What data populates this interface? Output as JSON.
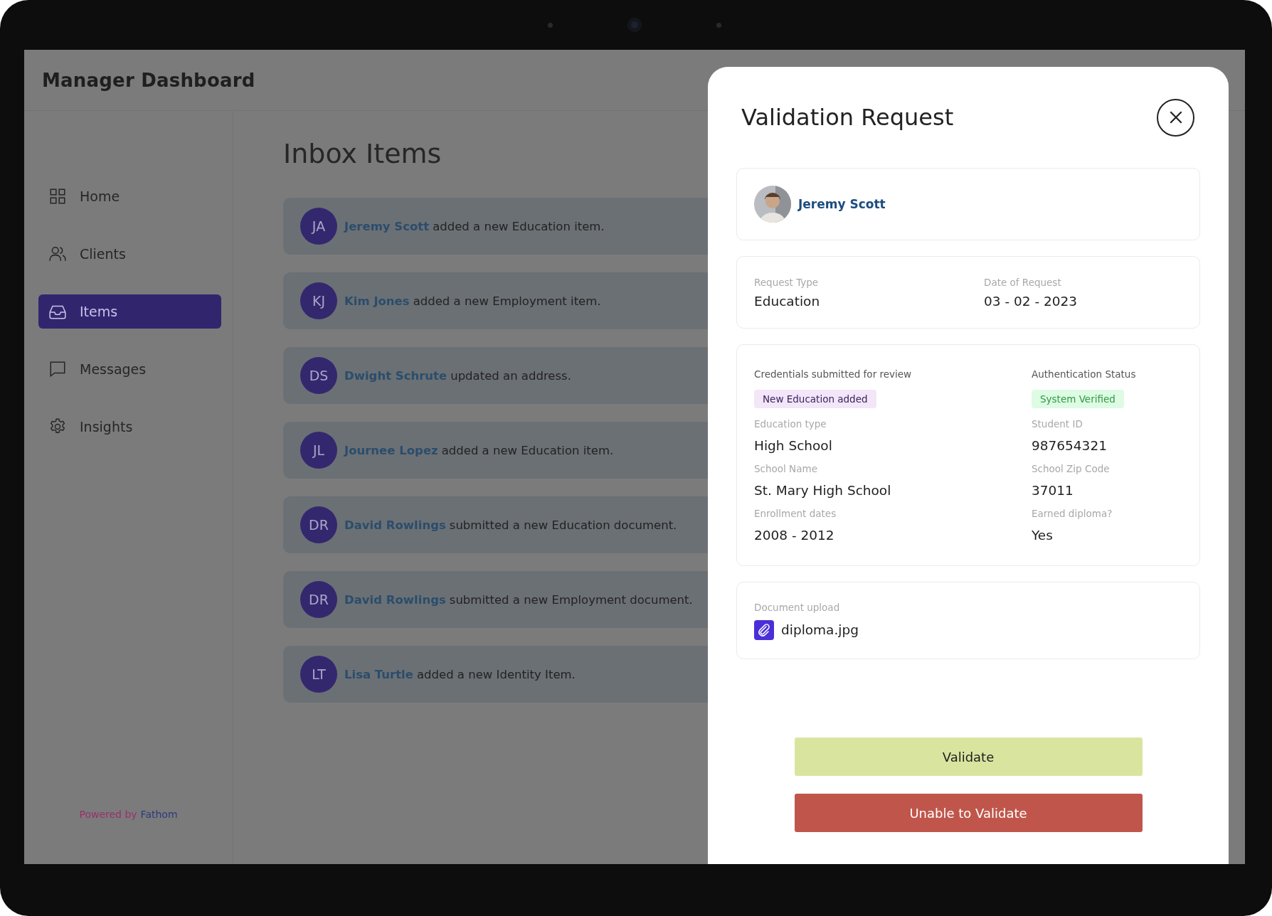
{
  "app": {
    "title": "Manager Dashboard"
  },
  "sidebar": {
    "items": [
      {
        "label": "Home",
        "kind": "grid",
        "selected": false
      },
      {
        "label": "Clients",
        "kind": "people",
        "selected": false
      },
      {
        "label": "Items",
        "kind": "inbox",
        "selected": true
      },
      {
        "label": "Messages",
        "kind": "chat",
        "selected": false
      },
      {
        "label": "Insights",
        "kind": "gear",
        "selected": false
      }
    ],
    "footer": {
      "prefix": "Powered by",
      "brand": "Fathom"
    }
  },
  "inbox": {
    "title": "Inbox Items",
    "items": [
      {
        "initials": "JA",
        "name": "Jeremy Scott",
        "action": "added a new Education item."
      },
      {
        "initials": "KJ",
        "name": "Kim Jones",
        "action": "added a new Employment item."
      },
      {
        "initials": "DS",
        "name": "Dwight Schrute",
        "action": "updated an address."
      },
      {
        "initials": "JL",
        "name": "Journee Lopez",
        "action": "added a new Education item."
      },
      {
        "initials": "DR",
        "name": "David Rowlings",
        "action": "submitted a new Education document."
      },
      {
        "initials": "DR",
        "name": "David Rowlings",
        "action": "submitted a new Employment document."
      },
      {
        "initials": "LT",
        "name": "Lisa Turtle",
        "action": "added a new Identity Item."
      }
    ]
  },
  "modal": {
    "title": "Validation Request",
    "client": {
      "name": "Jeremy Scott"
    },
    "request": [
      {
        "label": "Request Type",
        "value": "Education"
      },
      {
        "label": "Date of Request",
        "value": "03 - 02 - 2023"
      }
    ],
    "credentials": {
      "heading": "Credentials submitted for review",
      "tag": "New Education added",
      "status_heading": "Authentication Status",
      "status": "System Verified",
      "fields": [
        {
          "label": "Education type",
          "value": "High School"
        },
        {
          "label": "Student ID",
          "value": "987654321"
        },
        {
          "label": "School Name",
          "value": "St. Mary High School"
        },
        {
          "label": "School Zip Code",
          "value": "37011"
        },
        {
          "label": "Enrollment dates",
          "value": "2008 - 2012"
        },
        {
          "label": "Earned diploma?",
          "value": "Yes"
        }
      ]
    },
    "document": {
      "label": "Document upload",
      "file": "diploma.jpg"
    },
    "buttons": [
      {
        "label": "Validate",
        "kind": "primary"
      },
      {
        "label": "Unable to Validate",
        "kind": "danger"
      }
    ]
  }
}
